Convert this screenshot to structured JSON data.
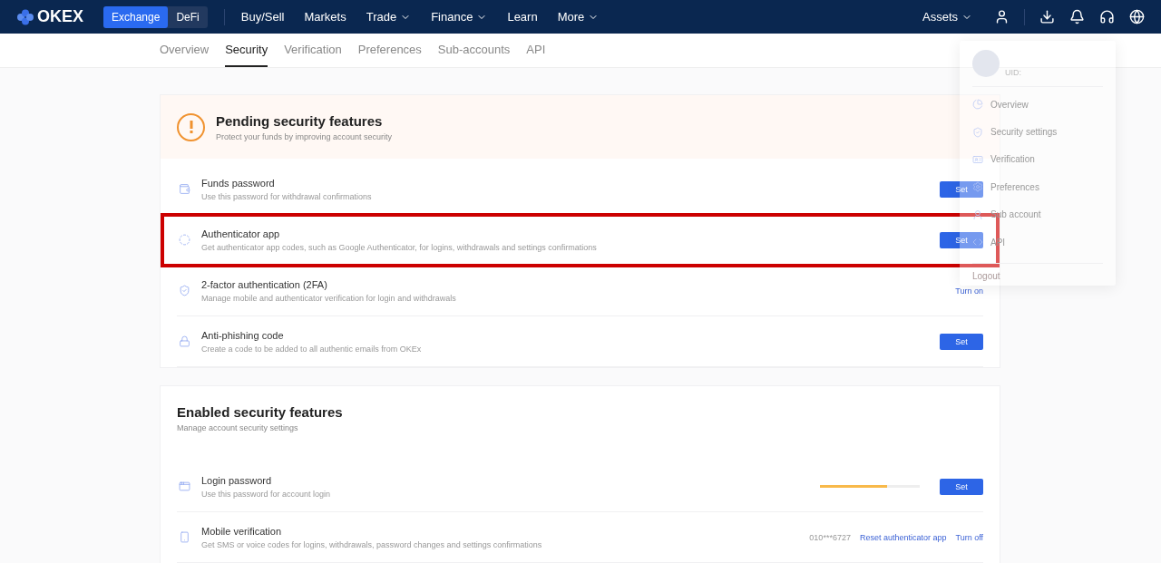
{
  "topbar": {
    "logo": "OKEX",
    "modes": [
      {
        "label": "Exchange",
        "selected": true
      },
      {
        "label": "DeFi",
        "selected": false
      }
    ],
    "nav": [
      {
        "label": "Buy/Sell",
        "dropdown": false
      },
      {
        "label": "Markets",
        "dropdown": false
      },
      {
        "label": "Trade",
        "dropdown": true
      },
      {
        "label": "Finance",
        "dropdown": true
      },
      {
        "label": "Learn",
        "dropdown": false
      },
      {
        "label": "More",
        "dropdown": true
      }
    ],
    "assets": "Assets"
  },
  "tabs": [
    {
      "label": "Overview",
      "selected": false
    },
    {
      "label": "Security",
      "selected": true
    },
    {
      "label": "Verification",
      "selected": false
    },
    {
      "label": "Preferences",
      "selected": false
    },
    {
      "label": "Sub-accounts",
      "selected": false
    },
    {
      "label": "API",
      "selected": false
    }
  ],
  "pending": {
    "title": "Pending security features",
    "subtitle": "Protect your funds by improving account security",
    "items": [
      {
        "title": "Funds password",
        "description": "Use this password for withdrawal confirmations",
        "highlighted": false,
        "actions": [
          {
            "kind": "button",
            "label": "Set"
          }
        ]
      },
      {
        "title": "Authenticator app",
        "description": "Get authenticator app codes, such as Google Authenticator, for logins, withdrawals and settings confirmations",
        "highlighted": true,
        "actions": [
          {
            "kind": "button",
            "label": "Set"
          }
        ]
      },
      {
        "title": "2-factor authentication (2FA)",
        "description": "Manage mobile and authenticator verification for login and withdrawals",
        "highlighted": false,
        "actions": [
          {
            "kind": "link",
            "label": "Turn on"
          }
        ]
      },
      {
        "title": "Anti-phishing code",
        "description": "Create a code to be added to all authentic emails from OKEx",
        "highlighted": false,
        "actions": [
          {
            "kind": "button",
            "label": "Set"
          }
        ]
      }
    ]
  },
  "enabled": {
    "title": "Enabled security features",
    "subtitle": "Manage account security settings",
    "items": [
      {
        "title": "Login password",
        "description": "Use this password for account login",
        "highlighted": false,
        "level": 0.67,
        "actions": [
          {
            "kind": "button",
            "label": "Set"
          }
        ]
      },
      {
        "title": "Mobile verification",
        "description": "Get SMS or voice codes for logins, withdrawals, password changes and settings confirmations",
        "highlighted": false,
        "actions": [
          {
            "kind": "text",
            "label": "010***6727"
          },
          {
            "kind": "link",
            "label": "Reset authenticator app"
          },
          {
            "kind": "link",
            "label": "Turn off"
          }
        ]
      }
    ]
  },
  "account_menu": {
    "uid": "UID:",
    "items": [
      {
        "label": "Overview"
      },
      {
        "label": "Security settings"
      },
      {
        "label": "Verification"
      },
      {
        "label": "Preferences"
      },
      {
        "label": "Sub account"
      },
      {
        "label": "API"
      }
    ],
    "logout": "Logout"
  }
}
